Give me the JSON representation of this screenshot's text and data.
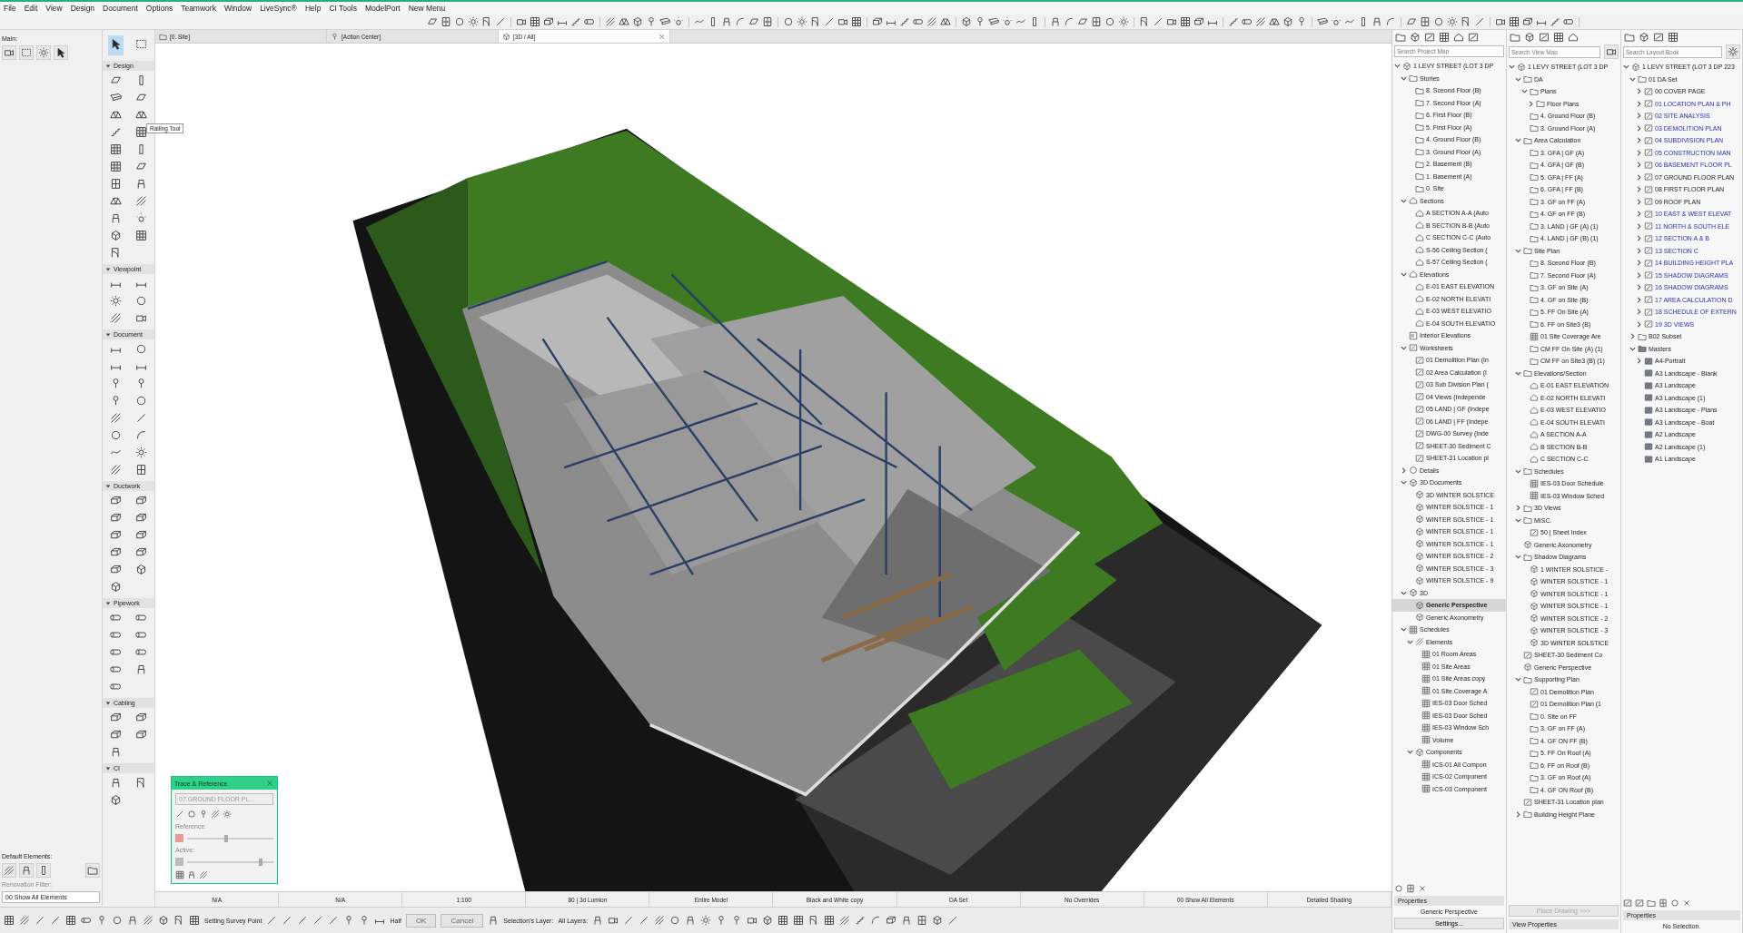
{
  "menu": [
    "File",
    "Edit",
    "View",
    "Design",
    "Document",
    "Options",
    "Teamwork",
    "Window",
    "LiveSync®",
    "Help",
    "CI Tools",
    "ModelPort",
    "New Menu"
  ],
  "toolbox": {
    "label": "Main:",
    "top_tools": [
      {
        "selected": true
      },
      {
        "selected": false
      }
    ],
    "sections": [
      {
        "title": "Design",
        "expanded": true
      },
      {
        "title": "Viewpoint",
        "expanded": true
      },
      {
        "title": "Document",
        "expanded": true
      },
      {
        "title": "Ductwork",
        "expanded": true
      },
      {
        "title": "Pipework",
        "expanded": true
      },
      {
        "title": "Cabling",
        "expanded": true
      },
      {
        "title": "CI",
        "expanded": true
      }
    ],
    "tooltip": "Railing Tool",
    "default_elements_label": "Default Elements:",
    "renovation_filter_label": "Renovation Filter:",
    "renovation_filter_value": "00 Show All Elements"
  },
  "tabs": [
    {
      "label": "[0. Site]",
      "selected": false
    },
    {
      "label": "[Action Center]",
      "selected": false
    },
    {
      "label": "[3D / All]",
      "selected": true
    }
  ],
  "trace_reference": {
    "title": "Trace & Reference",
    "source": "07 GROUND FLOOR PL...",
    "disabled": true,
    "reference_label": "Reference:",
    "reference_slider": {
      "level": 0.45
    },
    "active_label": "Active:",
    "active_slider": {
      "level": 0.85
    }
  },
  "quick_options": [
    "N/A",
    "N/A",
    "1:100",
    "80 | 3d Lumion",
    "Entire Model",
    "Black and White copy",
    "DA Set",
    "No Overrides",
    "00 Show All Elements",
    "Detailed Shading"
  ],
  "bottom_toolbar": {
    "survey_point": "Setting Survey Point",
    "half": "Half",
    "ok": {
      "label": "OK",
      "disabled": true
    },
    "cancel": {
      "label": "Cancel",
      "disabled": true
    },
    "selection_layer_label": "Selection's Layer:",
    "all_layers_label": "All Layers:"
  },
  "project_map": {
    "placeholder": "Search Project Map",
    "items": [
      {
        "label": "1 LEVY STREET (LOT 3 DP",
        "kind": "root",
        "expanded": true,
        "selected": false,
        "children": [
          {
            "label": "Stories",
            "kind": "folder",
            "expanded": true,
            "selected": false,
            "children": [
              {
                "label": "8. Sceond Floor (B)",
                "kind": "story",
                "selected": false
              },
              {
                "label": "7. Second Floor (A)",
                "kind": "story",
                "selected": false
              },
              {
                "label": "6. First Floor (B)",
                "kind": "story",
                "selected": false
              },
              {
                "label": "5. First Floor (A)",
                "kind": "story",
                "selected": false
              },
              {
                "label": "4. Ground Floor (B)",
                "kind": "story",
                "selected": false
              },
              {
                "label": "3. Ground Floor (A)",
                "kind": "story",
                "selected": false
              },
              {
                "label": "2. Basement (B)",
                "kind": "story",
                "selected": false
              },
              {
                "label": "1. Basement (A)",
                "kind": "story",
                "selected": false
              },
              {
                "label": "0. Site",
                "kind": "story",
                "selected": false
              }
            ]
          },
          {
            "label": "Sections",
            "kind": "section",
            "expanded": true,
            "selected": false,
            "children": [
              {
                "label": "A SECTION A-A (Auto",
                "kind": "section",
                "selected": false
              },
              {
                "label": "B SECTION B-B (Auto",
                "kind": "section",
                "selected": false
              },
              {
                "label": "C SECTION C-C (Auto",
                "kind": "section",
                "selected": false
              },
              {
                "label": "S-56 Ceiling Section (",
                "kind": "section",
                "selected": false
              },
              {
                "label": "S-57 Ceiling Section (",
                "kind": "section",
                "selected": false
              }
            ]
          },
          {
            "label": "Elevations",
            "kind": "elevation",
            "expanded": true,
            "selected": false,
            "children": [
              {
                "label": "E-01 EAST ELEVATION",
                "kind": "elevation",
                "selected": false
              },
              {
                "label": "E-02 NORTH ELEVATI",
                "kind": "elevation",
                "selected": false
              },
              {
                "label": "E-03 WEST ELEVATIO",
                "kind": "elevation",
                "selected": false
              },
              {
                "label": "E-04 SOUTH ELEVATIO",
                "kind": "elevation",
                "selected": false
              }
            ]
          },
          {
            "label": "Interior Elevations",
            "kind": "interior",
            "selected": false
          },
          {
            "label": "Worksheets",
            "kind": "worksheet",
            "expanded": true,
            "selected": false,
            "children": [
              {
                "label": "01 Demolition Plan (In",
                "kind": "worksheet",
                "selected": false
              },
              {
                "label": "02 Area Calculation (I",
                "kind": "worksheet",
                "selected": false
              },
              {
                "label": "03 Sub Division Plan (",
                "kind": "worksheet",
                "selected": false
              },
              {
                "label": "04 Views (Independe",
                "kind": "worksheet",
                "selected": false
              },
              {
                "label": "05 LAND | GF (Indepe",
                "kind": "worksheet",
                "selected": false
              },
              {
                "label": "06 LAND | FF (Indepe",
                "kind": "worksheet",
                "selected": false
              },
              {
                "label": "DWG-00 Survey (Inde",
                "kind": "worksheet",
                "selected": false
              },
              {
                "label": "SHEET-30 Sediment C",
                "kind": "worksheet",
                "selected": false
              },
              {
                "label": "SHEET-31 Location pl",
                "kind": "worksheet",
                "selected": false
              }
            ]
          },
          {
            "label": "Details",
            "kind": "detail",
            "expanded": false,
            "selected": false
          },
          {
            "label": "3D Documents",
            "kind": "doc3d",
            "expanded": true,
            "selected": false,
            "children": [
              {
                "label": "3D WINTER SOLSTICE",
                "kind": "doc3d",
                "selected": false
              },
              {
                "label": "WINTER SOLSTICE - 1",
                "kind": "doc3d",
                "selected": false
              },
              {
                "label": "WINTER SOLSTICE - 1",
                "kind": "doc3d",
                "selected": false
              },
              {
                "label": "WINTER SOLSTICE - 1",
                "kind": "doc3d",
                "selected": false
              },
              {
                "label": "WINTER SOLSTICE - 1",
                "kind": "doc3d",
                "selected": false
              },
              {
                "label": "WINTER SOLSTICE - 2",
                "kind": "doc3d",
                "selected": false
              },
              {
                "label": "WINTER SOLSTICE - 3",
                "kind": "doc3d",
                "selected": false
              },
              {
                "label": "WINTER SOLSTICE - 9",
                "kind": "doc3d",
                "selected": false
              }
            ]
          },
          {
            "label": "3D",
            "kind": "perspective",
            "expanded": true,
            "selected": false,
            "children": [
              {
                "label": "Generic Perspective",
                "kind": "perspective",
                "selected": true
              },
              {
                "label": "Generic Axonometry",
                "kind": "axonometry",
                "selected": false
              }
            ]
          },
          {
            "label": "Schedules",
            "kind": "schedule",
            "expanded": true,
            "selected": false,
            "children": [
              {
                "label": "Elements",
                "kind": "elements",
                "expanded": true,
                "selected": false,
                "children": [
                  {
                    "label": "01 Room Areas",
                    "kind": "schedule",
                    "selected": false
                  },
                  {
                    "label": "01 Site Areas",
                    "kind": "schedule",
                    "selected": false
                  },
                  {
                    "label": "01 Site Areas copy",
                    "kind": "schedule",
                    "selected": false
                  },
                  {
                    "label": "01 Site Coverage A",
                    "kind": "schedule",
                    "selected": false
                  },
                  {
                    "label": "IES-03 Door Sched",
                    "kind": "schedule",
                    "selected": false
                  },
                  {
                    "label": "IES-03 Door Sched",
                    "kind": "schedule",
                    "selected": false
                  },
                  {
                    "label": "IES-03 Window Sch",
                    "kind": "schedule",
                    "selected": false
                  },
                  {
                    "label": "Volume",
                    "kind": "schedule",
                    "selected": false
                  }
                ]
              },
              {
                "label": "Components",
                "kind": "components",
                "expanded": true,
                "selected": false,
                "children": [
                  {
                    "label": "ICS-01 All Compon",
                    "kind": "schedule",
                    "selected": false
                  },
                  {
                    "label": "ICS-02 Component",
                    "kind": "schedule",
                    "selected": false
                  },
                  {
                    "label": "ICS-03 Component",
                    "kind": "schedule",
                    "selected": false
                  }
                ]
              }
            ]
          }
        ]
      }
    ],
    "properties_title": "Properties",
    "properties_value": "Generic Perspective",
    "settings_button": "Settings..."
  },
  "view_map": {
    "placeholder": "Search View Map",
    "items": [
      {
        "label": "1 LEVY STREET (LOT 3 DP",
        "kind": "root",
        "expanded": true,
        "children": [
          {
            "label": "DA",
            "kind": "folder",
            "expanded": true,
            "children": [
              {
                "label": "Plans",
                "kind": "folder",
                "expanded": true,
                "children": [
                  {
                    "label": "Floor Plans",
                    "kind": "plan",
                    "expanded": false
                  }
                ]
              },
              {
                "label": "4. Ground Floor (B)",
                "kind": "plan"
              },
              {
                "label": "3. Ground Floor (A)",
                "kind": "plan"
              }
            ]
          },
          {
            "label": "Area Calculation",
            "kind": "folder",
            "expanded": true,
            "children": [
              {
                "label": "3. GFA | GF (A)",
                "kind": "plan"
              },
              {
                "label": "4. GFA | GF (B)",
                "kind": "plan"
              },
              {
                "label": "5. GFA | FF (A)",
                "kind": "plan"
              },
              {
                "label": "6. GFA | FF (B)",
                "kind": "plan"
              },
              {
                "label": "3. GF on FF (A)",
                "kind": "plan"
              },
              {
                "label": "4. GF on FF (B)",
                "kind": "plan"
              },
              {
                "label": "3. LAND | GF (A)  (1)",
                "kind": "plan"
              },
              {
                "label": "4. LAND | GF (B) (1)",
                "kind": "plan"
              }
            ]
          },
          {
            "label": "Site Plan",
            "kind": "folder",
            "expanded": true,
            "children": [
              {
                "label": "8. Sceond Floor (B)",
                "kind": "plan"
              },
              {
                "label": "7. Second Floor (A)",
                "kind": "plan"
              },
              {
                "label": "3. GF on Site (A)",
                "kind": "plan"
              },
              {
                "label": "4. GF on Site (B)",
                "kind": "plan"
              },
              {
                "label": "5. FF On Site (A)",
                "kind": "plan"
              },
              {
                "label": "6. FF on Site3 (B)",
                "kind": "plan"
              },
              {
                "label": "01 Site Coverage Are",
                "kind": "schedule"
              },
              {
                "label": "CM FF On Site (A) (1)",
                "kind": "plan"
              },
              {
                "label": "CM FF on Site3 (B) (1)",
                "kind": "plan"
              }
            ]
          },
          {
            "label": "Elevations/Section",
            "kind": "folder",
            "expanded": true,
            "children": [
              {
                "label": "E-01 EAST ELEVATION",
                "kind": "elevation"
              },
              {
                "label": "E-02 NORTH ELEVATI",
                "kind": "elevation"
              },
              {
                "label": "E-03 WEST ELEVATIO",
                "kind": "elevation"
              },
              {
                "label": "E-04 SOUTH ELEVATI",
                "kind": "elevation"
              },
              {
                "label": "A SECTION A-A",
                "kind": "section"
              },
              {
                "label": "B SECTION B-B",
                "kind": "section"
              },
              {
                "label": "C SECTION C-C",
                "kind": "section"
              }
            ]
          },
          {
            "label": "Schedules",
            "kind": "folder",
            "expanded": true,
            "children": [
              {
                "label": "IES-03 Door Schedule",
                "kind": "schedule"
              },
              {
                "label": "IES-03 Window Sched",
                "kind": "schedule"
              }
            ]
          },
          {
            "label": "3D Views",
            "kind": "folder",
            "expanded": false
          },
          {
            "label": "MISC.",
            "kind": "folder",
            "expanded": true,
            "children": [
              {
                "label": "50 | Sheet Index",
                "kind": "worksheet"
              }
            ]
          },
          {
            "label": "Generic Axonometry",
            "kind": "axonometry"
          },
          {
            "label": "Shadow Diagrams",
            "kind": "folder",
            "expanded": true,
            "children": [
              {
                "label": "1 WINTER SOLSTICE -",
                "kind": "doc3d"
              },
              {
                "label": "WINTER SOLSTICE - 1",
                "kind": "doc3d"
              },
              {
                "label": "WINTER SOLSTICE - 1",
                "kind": "doc3d"
              },
              {
                "label": "WINTER SOLSTICE - 1",
                "kind": "doc3d"
              },
              {
                "label": "WINTER SOLSTICE - 2",
                "kind": "doc3d"
              },
              {
                "label": "WINTER SOLSTICE - 3",
                "kind": "doc3d"
              },
              {
                "label": "3D WINTER SOLSTICE",
                "kind": "doc3d"
              }
            ]
          },
          {
            "label": "SHEET-30 Sediment Co",
            "kind": "worksheet"
          },
          {
            "label": "Generic Perspective",
            "kind": "perspective"
          },
          {
            "label": "Supporting Plan",
            "kind": "folder",
            "expanded": true,
            "children": [
              {
                "label": "01 Demolition Plan",
                "kind": "worksheet"
              },
              {
                "label": "01 Demolition Plan (1",
                "kind": "worksheet"
              },
              {
                "label": "0. Site on FF",
                "kind": "plan"
              },
              {
                "label": "3. GF on FF (A)",
                "kind": "plan"
              },
              {
                "label": "4. GF ON FF (B)",
                "kind": "plan"
              },
              {
                "label": "5. FF On Roof (A)",
                "kind": "plan"
              },
              {
                "label": "6. FF on Roof (B)",
                "kind": "plan"
              },
              {
                "label": "3. GF on Roof (A)",
                "kind": "plan"
              },
              {
                "label": "4. GF ON Roof (B)",
                "kind": "plan"
              }
            ]
          },
          {
            "label": "SHEET-31 Location plan",
            "kind": "worksheet"
          },
          {
            "label": "Building Height Plane",
            "kind": "folder",
            "expanded": false
          }
        ]
      }
    ],
    "place_drawing": {
      "label": "Place Drawing >>>",
      "disabled": true
    },
    "properties_button": "View Properties"
  },
  "layout_book": {
    "placeholder": "Search Layout Book",
    "items": [
      {
        "label": "1 LEVY STREET (LOT 3 DP 223",
        "kind": "root",
        "expanded": true,
        "children": [
          {
            "label": "01 DA Set",
            "kind": "subset",
            "expanded": true,
            "children": [
              {
                "label": "00 COVER PAGE",
                "kind": "layout",
                "expanded": false,
                "linked": false
              },
              {
                "label": "01 LOCATION PLAN & PH",
                "kind": "layout",
                "expanded": false,
                "linked": true
              },
              {
                "label": "02 SITE ANALYSIS",
                "kind": "layout",
                "expanded": false,
                "linked": true
              },
              {
                "label": "03 DEMOLITION PLAN",
                "kind": "layout",
                "expanded": false,
                "linked": true
              },
              {
                "label": "04 SUBDIVISION PLAN",
                "kind": "layout",
                "expanded": false,
                "linked": true
              },
              {
                "label": "05 CONSTRUCTION MAN",
                "kind": "layout",
                "expanded": false,
                "linked": true
              },
              {
                "label": "06 BASEMENT FLOOR PL",
                "kind": "layout",
                "expanded": false,
                "linked": true
              },
              {
                "label": "07 GROUND FLOOR PLAN",
                "kind": "layout",
                "expanded": false,
                "linked": false
              },
              {
                "label": "08 FIRST FLOOR PLAN",
                "kind": "layout",
                "expanded": false,
                "linked": false
              },
              {
                "label": "09 ROOF PLAN",
                "kind": "layout",
                "expanded": false,
                "linked": false
              },
              {
                "label": "10 EAST & WEST ELEVAT",
                "kind": "layout",
                "expanded": false,
                "linked": true
              },
              {
                "label": "11 NORTH & SOUTH ELE",
                "kind": "layout",
                "expanded": false,
                "linked": true
              },
              {
                "label": "12 SECTION A & B",
                "kind": "layout",
                "expanded": false,
                "linked": true
              },
              {
                "label": "13 SECTION C",
                "kind": "layout",
                "expanded": false,
                "linked": true
              },
              {
                "label": "14 BUILDING HEIGHT PLA",
                "kind": "layout",
                "expanded": false,
                "linked": true
              },
              {
                "label": "15 SHADOW DIAGRAMS",
                "kind": "layout",
                "expanded": false,
                "linked": true
              },
              {
                "label": "16 SHADOW DIAGRAMS",
                "kind": "layout",
                "expanded": false,
                "linked": true
              },
              {
                "label": "17 AREA CALCULATION D",
                "kind": "layout",
                "expanded": false,
                "linked": true
              },
              {
                "label": "18 SCHEDULE OF EXTERN",
                "kind": "layout",
                "expanded": false,
                "linked": true
              },
              {
                "label": "19 3D VIEWS",
                "kind": "layout",
                "expanded": false,
                "linked": true
              }
            ]
          },
          {
            "label": "B02 Subset",
            "kind": "subset",
            "expanded": false
          },
          {
            "label": "Masters",
            "kind": "masters",
            "expanded": true,
            "children": [
              {
                "label": "A4-Portrait",
                "kind": "master",
                "expanded": false
              },
              {
                "label": "A3 Landscape - Blank",
                "kind": "master"
              },
              {
                "label": "A3 Landscape",
                "kind": "master"
              },
              {
                "label": "A3 Landscape (1)",
                "kind": "master"
              },
              {
                "label": "A3 Landscape - Plans",
                "kind": "master"
              },
              {
                "label": "A3 Landscape - Boat",
                "kind": "master"
              },
              {
                "label": "A2 Landscape",
                "kind": "master"
              },
              {
                "label": "A2 Landscape (1)",
                "kind": "master"
              },
              {
                "label": "A1 Landscape",
                "kind": "master"
              }
            ]
          }
        ]
      }
    ],
    "properties_title": "Properties",
    "properties_value": "No Selection."
  }
}
